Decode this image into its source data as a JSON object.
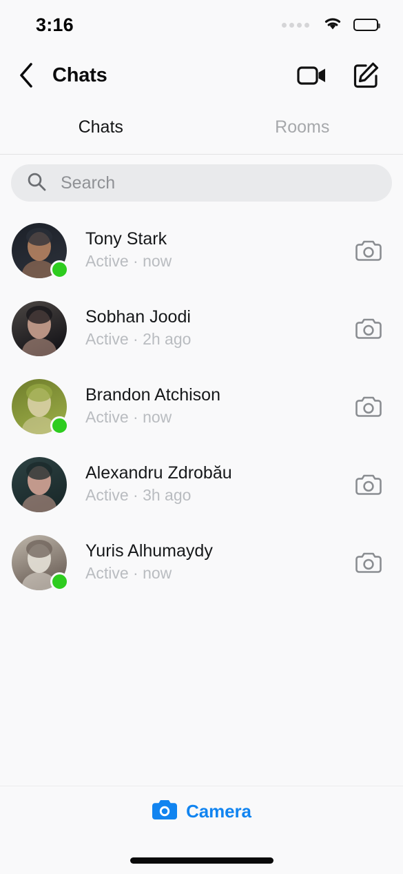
{
  "status_bar": {
    "time": "3:16",
    "signal_icon": "signal-dots-icon",
    "wifi_icon": "wifi-icon",
    "battery_icon": "battery-icon"
  },
  "header": {
    "back_icon": "chevron-left-icon",
    "title": "Chats",
    "video_call_icon": "video-camera-icon",
    "compose_icon": "compose-edit-icon"
  },
  "tabs": [
    {
      "label": "Chats",
      "active": true
    },
    {
      "label": "Rooms",
      "active": false
    }
  ],
  "search": {
    "icon": "search-icon",
    "placeholder": "Search",
    "value": ""
  },
  "chats": [
    {
      "name": "Tony Stark",
      "status": "Active · now",
      "online": true,
      "action_icon": "camera-outline-icon",
      "avatar_colors": [
        "#1c2028",
        "#b2805f",
        "#2a2f38"
      ]
    },
    {
      "name": "Sobhan Joodi",
      "status": "Active · 2h ago",
      "online": false,
      "action_icon": "camera-outline-icon",
      "avatar_colors": [
        "#4c4744",
        "#c59d8c",
        "#17161a"
      ]
    },
    {
      "name": "Brandon Atchison",
      "status": "Active · now",
      "online": true,
      "action_icon": "camera-outline-icon",
      "avatar_colors": [
        "#6f7d2c",
        "#d8cfa5",
        "#97a844"
      ]
    },
    {
      "name": "Alexandru Zdrobău",
      "status": "Active · 3h ago",
      "online": false,
      "action_icon": "camera-outline-icon",
      "avatar_colors": [
        "#2d4243",
        "#d0a294",
        "#1b2a2b"
      ]
    },
    {
      "name": "Yuris Alhumaydy",
      "status": "Active · now",
      "online": true,
      "action_icon": "camera-outline-icon",
      "avatar_colors": [
        "#bfb7ab",
        "#e3ded5",
        "#6e625a"
      ]
    }
  ],
  "bottom_bar": {
    "camera_icon": "camera-filled-icon",
    "camera_label": "Camera",
    "accent_color": "#1184f0"
  },
  "colors": {
    "background": "#f9f9fa",
    "online_green": "#2ecc1f",
    "accent_blue": "#1184f0",
    "text_primary": "#16181a",
    "text_secondary": "#b9bcc0"
  }
}
